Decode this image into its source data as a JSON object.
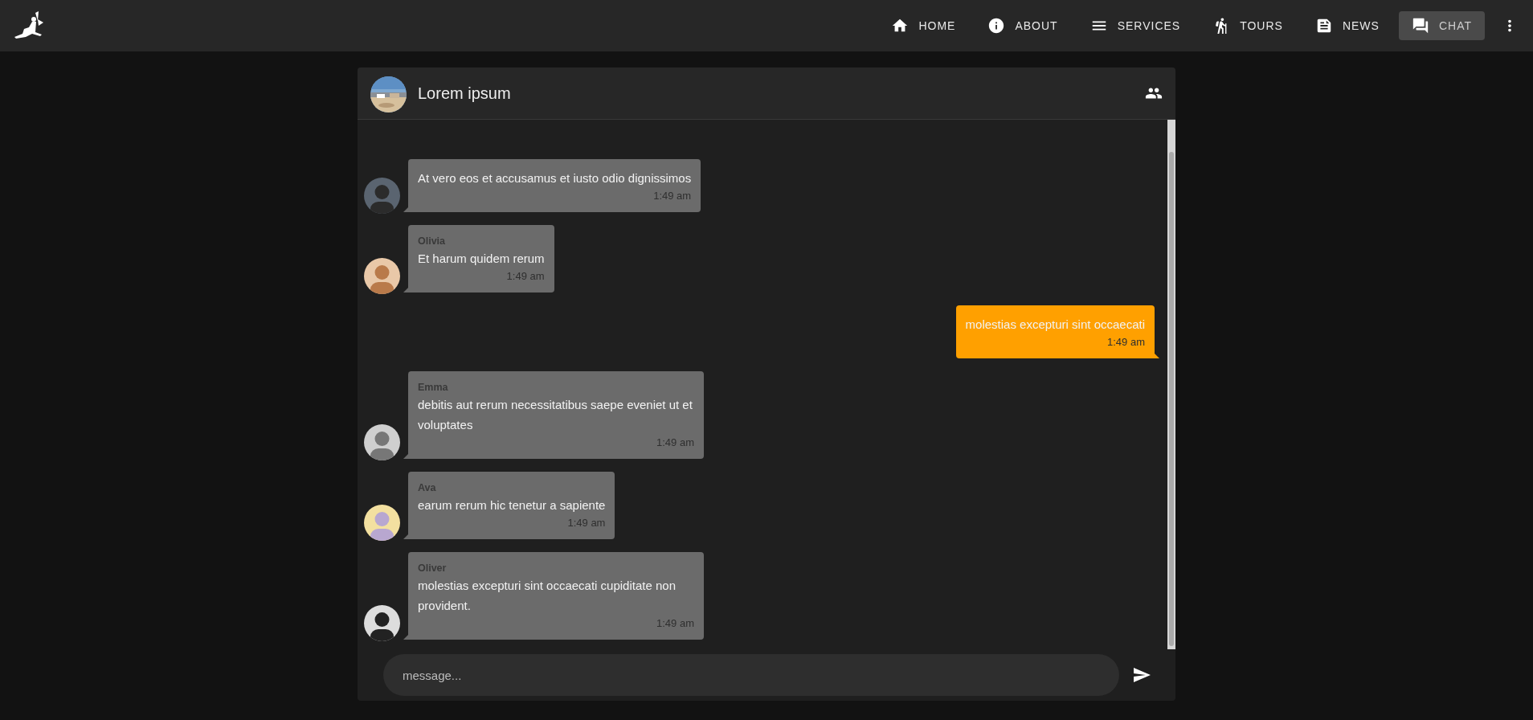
{
  "nav": {
    "items": [
      {
        "kind": "home",
        "label": "HOME",
        "selected": false
      },
      {
        "kind": "about",
        "label": "ABOUT",
        "selected": false
      },
      {
        "kind": "services",
        "label": "SERVICES",
        "selected": false
      },
      {
        "kind": "tours",
        "label": "TOURS",
        "selected": false
      },
      {
        "kind": "news",
        "label": "NEWS",
        "selected": false
      },
      {
        "kind": "chat",
        "label": "CHAT",
        "selected": true
      }
    ]
  },
  "chat": {
    "title": "Lorem ipsum",
    "messages": [
      {
        "own": false,
        "text": "At vero eos et accusamus et iusto odio dignissimos",
        "time": "1:49 am"
      },
      {
        "own": false,
        "sender": "Olivia",
        "text": "Et harum quidem rerum",
        "time": "1:49 am"
      },
      {
        "own": true,
        "text": "molestias excepturi sint occaecati",
        "time": "1:49 am"
      },
      {
        "own": false,
        "sender": "Emma",
        "text": "debitis aut rerum necessitatibus saepe eveniet ut et voluptates",
        "time": "1:49 am"
      },
      {
        "own": false,
        "sender": "Ava",
        "text": "earum rerum hic tenetur a sapiente",
        "time": "1:49 am"
      },
      {
        "own": false,
        "sender": "Oliver",
        "text": "molestias excepturi sint occaecati cupiditate non provident.",
        "time": "1:49 am"
      }
    ],
    "input": {
      "placeholder": "message..."
    }
  }
}
